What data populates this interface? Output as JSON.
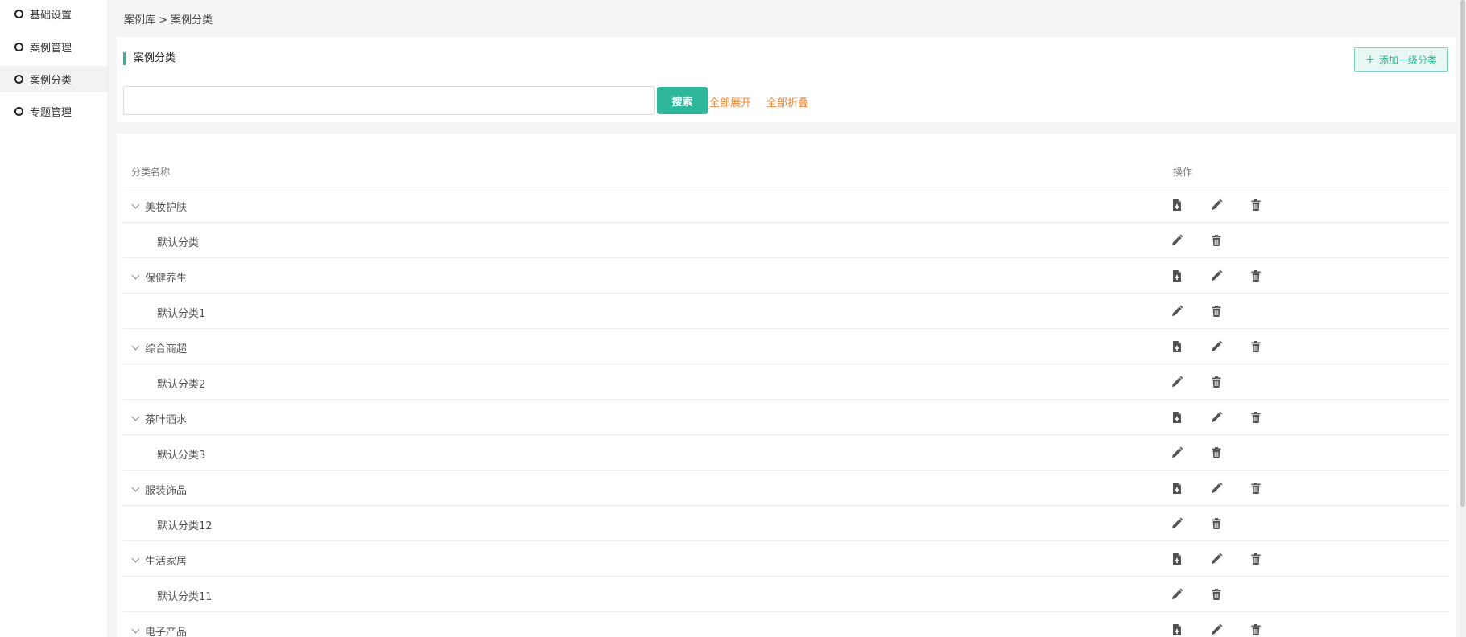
{
  "sidebar": {
    "items": [
      {
        "label": "基础设置",
        "active": false
      },
      {
        "label": "案例管理",
        "active": false
      },
      {
        "label": "案例分类",
        "active": true
      },
      {
        "label": "专题管理",
        "active": false
      }
    ]
  },
  "breadcrumb": "案例库 > 案例分类",
  "panel": {
    "title": "案例分类",
    "add_button": "添加一级分类",
    "search": {
      "value": "",
      "placeholder": "",
      "button": "搜索"
    },
    "expand_all": "全部展开",
    "collapse_all": "全部折叠"
  },
  "table": {
    "headers": {
      "name": "分类名称",
      "ops": "操作"
    },
    "rows": [
      {
        "label": "美妆护肤",
        "level": 1
      },
      {
        "label": "默认分类",
        "level": 2
      },
      {
        "label": "保健养生",
        "level": 1
      },
      {
        "label": "默认分类1",
        "level": 2
      },
      {
        "label": "综合商超",
        "level": 1
      },
      {
        "label": "默认分类2",
        "level": 2
      },
      {
        "label": "茶叶酒水",
        "level": 1
      },
      {
        "label": "默认分类3",
        "level": 2
      },
      {
        "label": "服装饰品",
        "level": 1
      },
      {
        "label": "默认分类12",
        "level": 2
      },
      {
        "label": "生活家居",
        "level": 1
      },
      {
        "label": "默认分类11",
        "level": 2
      },
      {
        "label": "电子产品",
        "level": 1
      }
    ]
  },
  "colors": {
    "accent": "#2eb79b",
    "link": "#f0883a",
    "icon": "#555555"
  },
  "icons": {
    "add_child": "file-plus-icon",
    "edit": "pencil-icon",
    "delete": "trash-icon",
    "expand": "chevron-down-icon"
  }
}
